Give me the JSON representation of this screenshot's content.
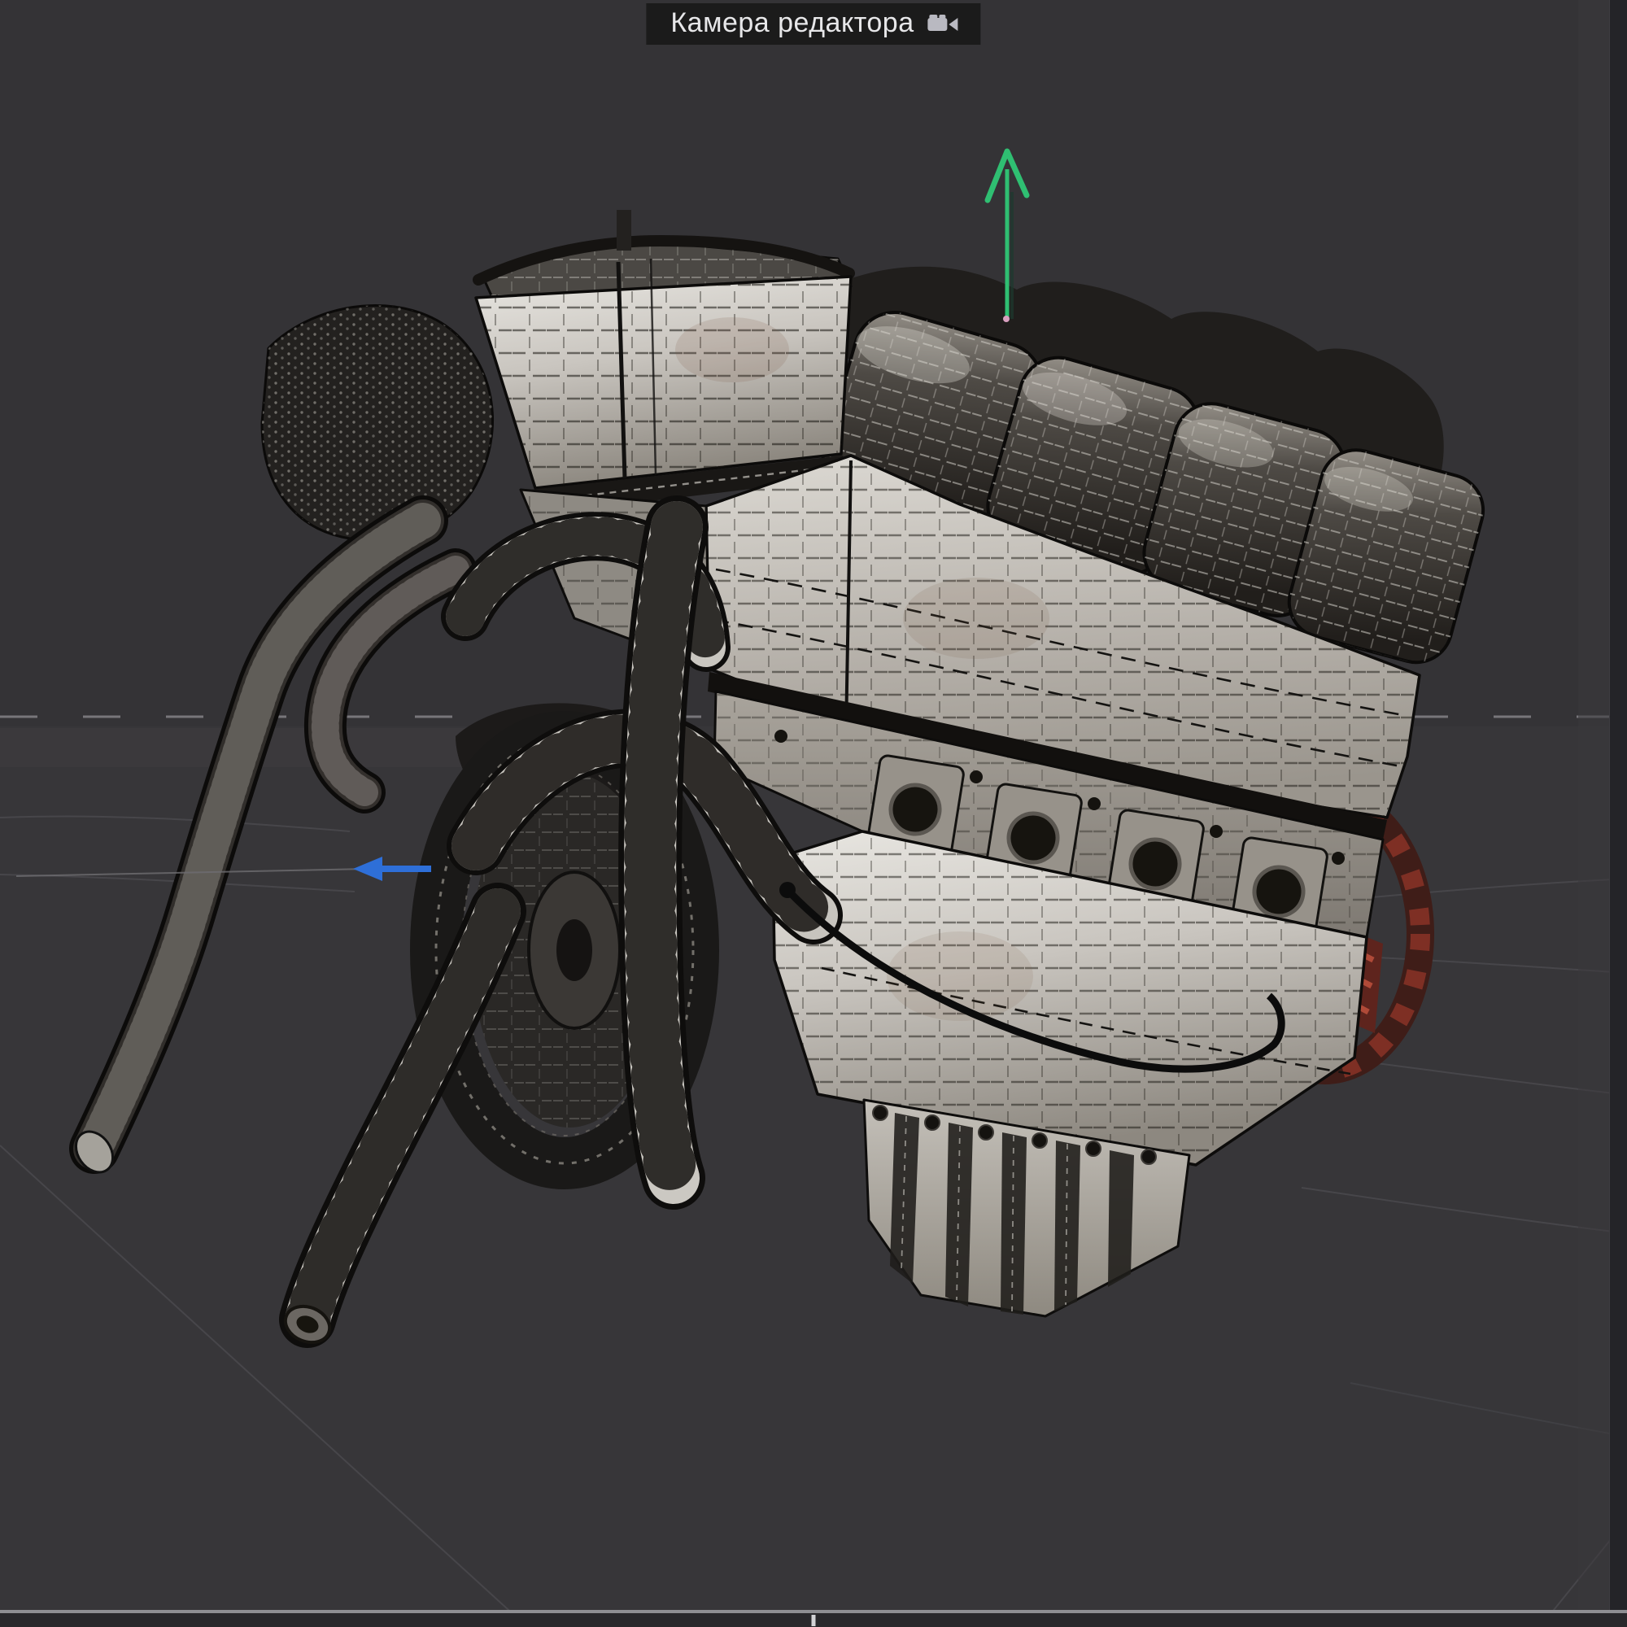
{
  "viewport": {
    "title": "Камера редактора",
    "title_icon": "movie-camera-icon"
  },
  "scene": {
    "object": "wireframe V8 engine model",
    "gizmo": {
      "up_arrow_color": "#2fbf72",
      "side_arrow_color": "#2e6fd8"
    },
    "horizon_dash_color": "#77767a",
    "grid_line_color": "#4a494e",
    "flywheel_red": "#8c2f24"
  },
  "colors": {
    "viewport_background": "#343336",
    "ground": "#373639",
    "title_bar_background": "#1b1b1b",
    "title_text": "#e7e7e9",
    "right_edge_strip": "#242428",
    "bottom_bar": "#29282b",
    "bottom_divider": "#8e8e92",
    "engine_light_surface": "#d6d3cd",
    "engine_dark_parts": "#2c2926",
    "wireframe_line": "#101010"
  }
}
